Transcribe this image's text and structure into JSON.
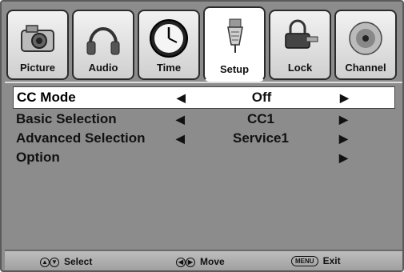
{
  "tabs": [
    {
      "label": "Picture",
      "icon": "camera-icon",
      "active": false
    },
    {
      "label": "Audio",
      "icon": "headphones-icon",
      "active": false
    },
    {
      "label": "Time",
      "icon": "clock-icon",
      "active": false
    },
    {
      "label": "Setup",
      "icon": "wrench-icon",
      "active": true
    },
    {
      "label": "Lock",
      "icon": "lock-icon",
      "active": false
    },
    {
      "label": "Channel",
      "icon": "satellite-dish-icon",
      "active": false
    }
  ],
  "menu": {
    "rows": [
      {
        "name": "CC Mode",
        "value": "Off",
        "has_left": true,
        "has_right": true,
        "selected": true
      },
      {
        "name": "Basic Selection",
        "value": "CC1",
        "has_left": true,
        "has_right": true,
        "selected": false
      },
      {
        "name": "Advanced Selection",
        "value": "Service1",
        "has_left": true,
        "has_right": true,
        "selected": false
      },
      {
        "name": "Option",
        "value": "",
        "has_left": false,
        "has_right": true,
        "selected": false
      }
    ],
    "left_arrow": "◀",
    "right_arrow": "▶"
  },
  "footer": {
    "select_label": "Select",
    "move_label": "Move",
    "menu_key": "MENU",
    "exit_label": "Exit"
  },
  "colors": {
    "panel": "#8c8c8c",
    "selected_row": "#ffffff"
  }
}
